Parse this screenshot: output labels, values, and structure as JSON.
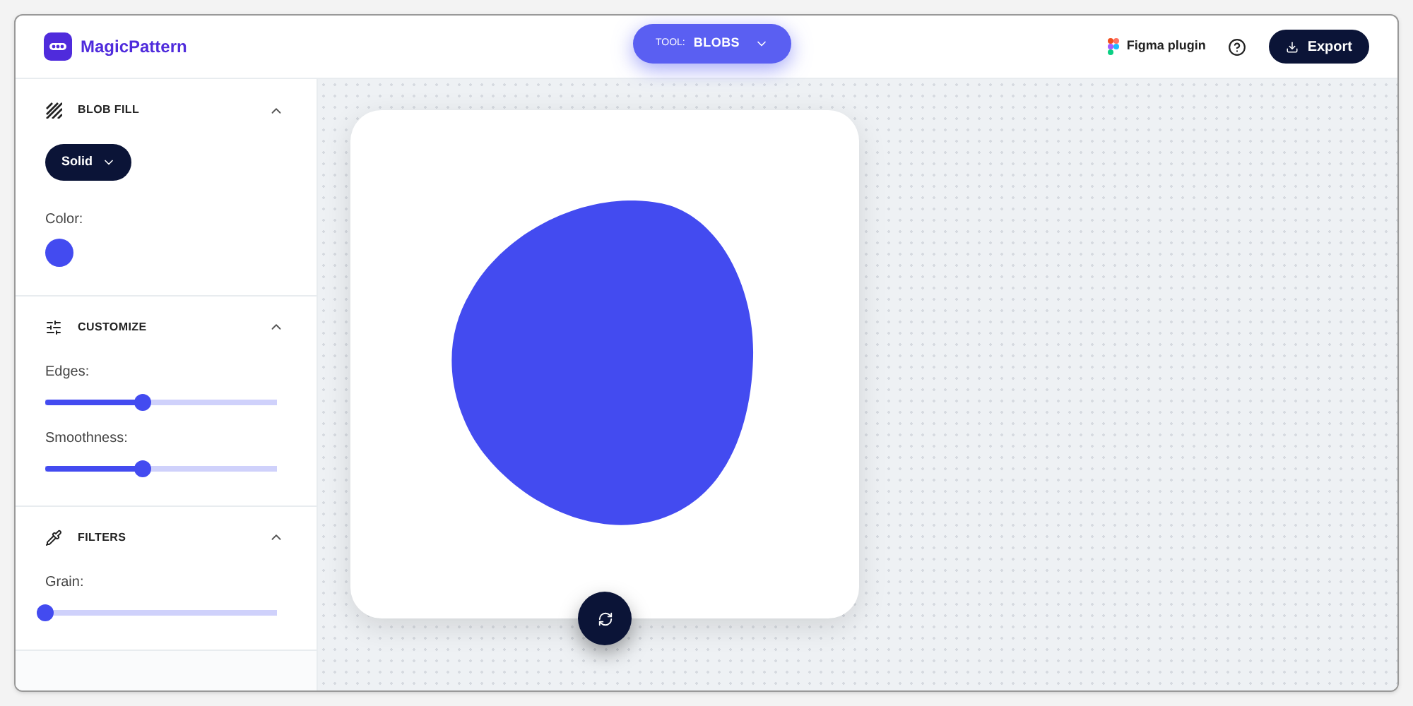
{
  "header": {
    "brand": "MagicPattern",
    "tool_label": "TOOL:",
    "tool_value": "BLOBS",
    "figma_link": "Figma plugin",
    "export_button": "Export"
  },
  "sections": [
    {
      "title": "BLOB FILL",
      "expanded": true,
      "fill_dropdown": "Solid",
      "color_label": "Color:",
      "color": "#434bf0"
    },
    {
      "title": "CUSTOMIZE",
      "expanded": true,
      "sliders": [
        {
          "label": "Edges:",
          "level": 0.42
        },
        {
          "label": "Smoothness:",
          "level": 0.42
        }
      ]
    },
    {
      "title": "FILTERS",
      "expanded": true,
      "sliders": [
        {
          "label": "Grain:",
          "level": 0
        }
      ]
    }
  ]
}
